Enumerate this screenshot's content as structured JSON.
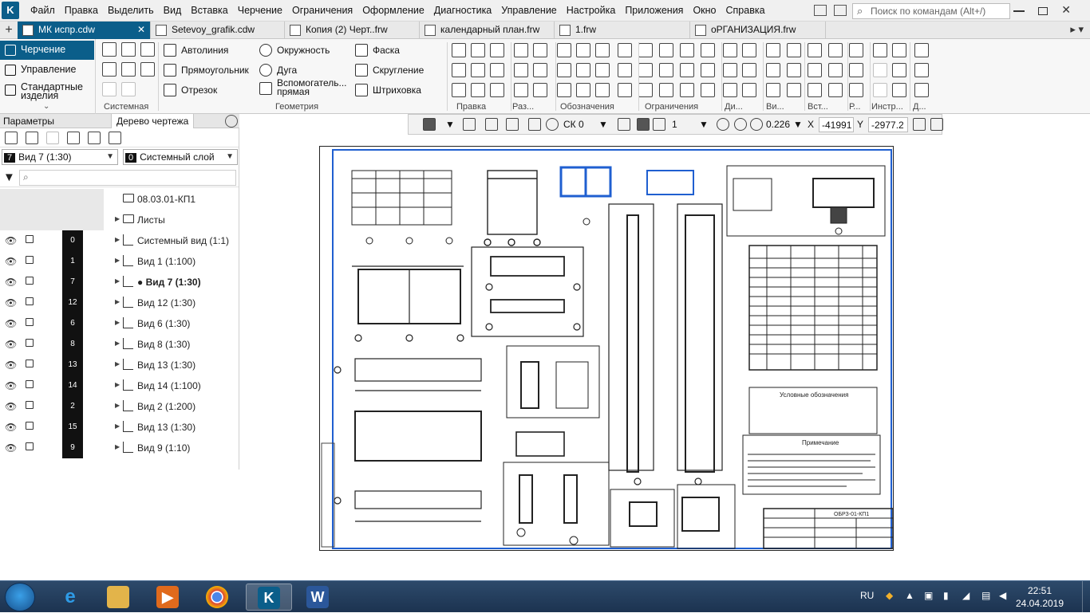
{
  "app": {
    "logo_letter": "K"
  },
  "menubar": {
    "items": [
      "Файл",
      "Правка",
      "Выделить",
      "Вид",
      "Вставка",
      "Черчение",
      "Ограничения",
      "Оформление",
      "Диагностика",
      "Управление",
      "Настройка",
      "Приложения",
      "Окно",
      "Справка"
    ],
    "search_placeholder": "Поиск по командам (Alt+/)"
  },
  "tabs": [
    {
      "label": "МК испр.cdw",
      "active": true
    },
    {
      "label": "Setevoy_grafik.cdw",
      "active": false
    },
    {
      "label": "Копия (2) Черт..frw",
      "active": false
    },
    {
      "label": "календарный план.frw",
      "active": false
    },
    {
      "label": "1.frw",
      "active": false
    },
    {
      "label": "оРГАНИЗАЦИЯ.frw",
      "active": false
    }
  ],
  "ribbon": {
    "modes": [
      "Черчение",
      "Управление",
      "Стандартные изделия"
    ],
    "groups": {
      "system": "Системная",
      "geometry": "Геометрия",
      "edit": "Правка",
      "dim": "Раз...",
      "notation": "Обозначения",
      "constraints": "Ограничения",
      "di": "Ди...",
      "vi": "Ви...",
      "vst": "Вст...",
      "r": "Р...",
      "instr": "Инстр...",
      "d": "Д..."
    },
    "geometry_buttons": {
      "autoline": "Автолиния",
      "rectangle": "Прямоугольник",
      "segment": "Отрезок",
      "circle": "Окружность",
      "arc": "Дуга",
      "aux_line": "Вспомогатель... прямая",
      "chamfer": "Фаска",
      "fillet": "Скругление",
      "hatch": "Штриховка"
    }
  },
  "panel": {
    "tabs": [
      "Параметры",
      "Дерево чертежа"
    ],
    "view_select": {
      "num": "7",
      "label": "Вид 7 (1:30)"
    },
    "layer_select": {
      "num": "0",
      "label": "Системный слой"
    },
    "filter_placeholder": "",
    "doc_name": "08.03.01-КП1",
    "sheets_label": "Листы",
    "views": [
      {
        "num": "0",
        "label": "Системный вид (1:1)",
        "bold": false
      },
      {
        "num": "1",
        "label": "Вид 1 (1:100)",
        "bold": false
      },
      {
        "num": "7",
        "label": "● Вид 7 (1:30)",
        "bold": true
      },
      {
        "num": "12",
        "label": "Вид 12 (1:30)",
        "bold": false
      },
      {
        "num": "6",
        "label": "Вид 6 (1:30)",
        "bold": false
      },
      {
        "num": "8",
        "label": "Вид 8 (1:30)",
        "bold": false
      },
      {
        "num": "13",
        "label": "Вид 13 (1:30)",
        "bold": false
      },
      {
        "num": "14",
        "label": "Вид 14 (1:100)",
        "bold": false
      },
      {
        "num": "2",
        "label": "Вид 2 (1:200)",
        "bold": false
      },
      {
        "num": "15",
        "label": "Вид 13 (1:30)",
        "bold": false
      },
      {
        "num": "9",
        "label": "Вид 9 (1:10)",
        "bold": false
      }
    ]
  },
  "canvas_toolbar": {
    "cs": "СК 0",
    "line_style": "1",
    "zoom": "0.226",
    "x_label": "X",
    "x_value": "-41991",
    "y_label": "Y",
    "y_value": "-2977.2"
  },
  "drawing": {
    "title_block_text": "ОБРЗ-01-КП1",
    "notes_title": "Примечание",
    "legend_title": "Условные обозначения"
  },
  "taskbar": {
    "lang": "RU",
    "time": "22:51",
    "date": "24.04.2019"
  },
  "colors": {
    "accent": "#0b5e8a",
    "taskbar": "#1c3350"
  }
}
